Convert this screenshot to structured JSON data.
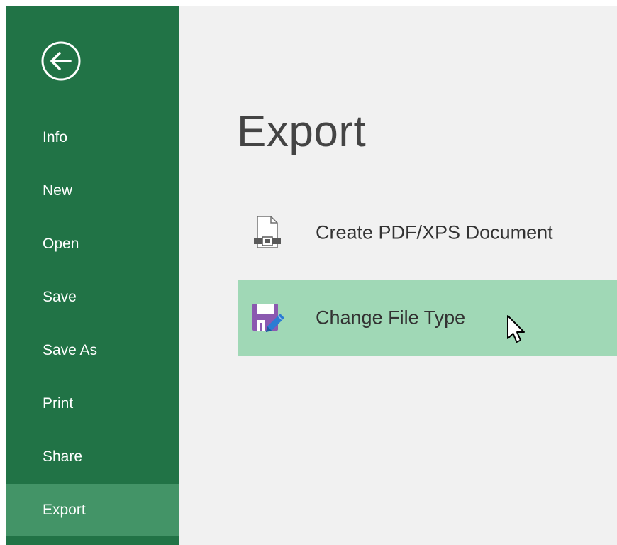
{
  "sidebar": {
    "back_icon": "back-arrow-circle-icon",
    "items": [
      {
        "label": "Info"
      },
      {
        "label": "New"
      },
      {
        "label": "Open"
      },
      {
        "label": "Save"
      },
      {
        "label": "Save As"
      },
      {
        "label": "Print"
      },
      {
        "label": "Share"
      },
      {
        "label": "Export",
        "active": true
      }
    ]
  },
  "main": {
    "title": "Export",
    "options": [
      {
        "label": "Create PDF/XPS Document",
        "icon": "pdf-document-icon"
      },
      {
        "label": "Change File Type",
        "icon": "save-edit-icon",
        "selected": true
      }
    ]
  },
  "colors": {
    "sidebar_bg": "#217346",
    "sidebar_active": "#439467",
    "content_bg": "#f1f1f1",
    "selected_option_bg": "#a0d8b6",
    "file_icon_purple": "#8b59b0"
  }
}
